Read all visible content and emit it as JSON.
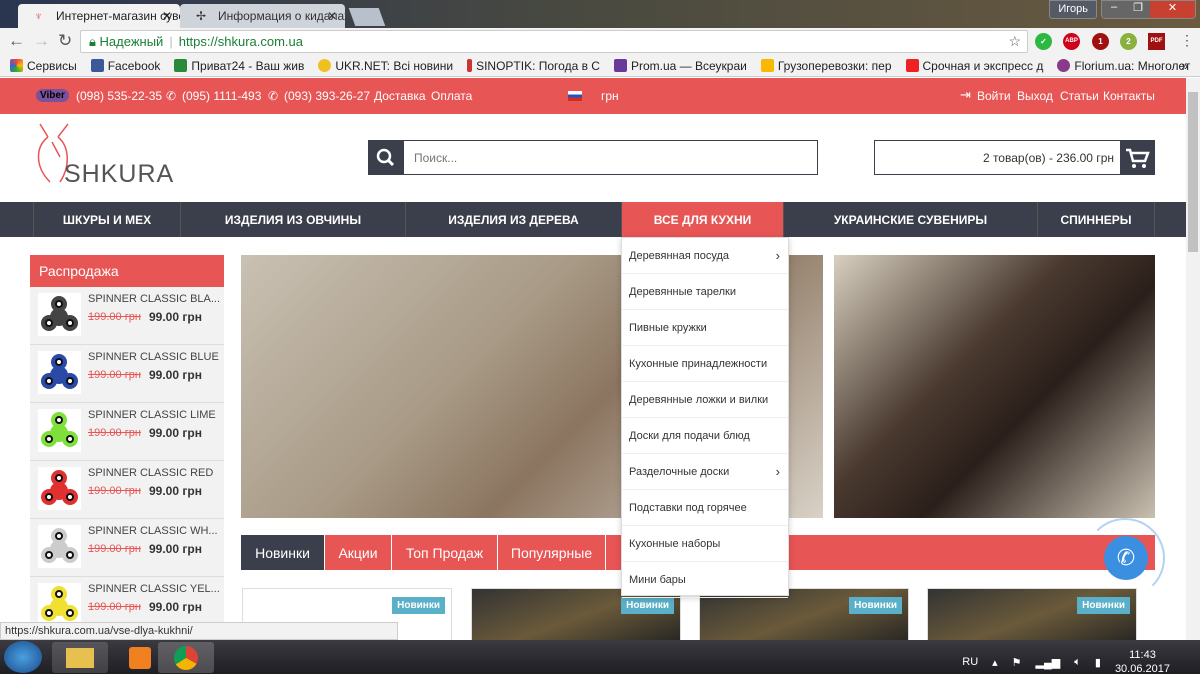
{
  "browser": {
    "tabs": [
      {
        "title": "Интернет-магазин сувенир",
        "close": "✕"
      },
      {
        "title": "Информация о кидалах",
        "close": "✕"
      }
    ],
    "user": "Игорь",
    "secure_label": "Надежный",
    "url": "https://shkura.com.ua",
    "bookmarks": [
      {
        "label": "Сервисы",
        "color": "#e44"
      },
      {
        "label": "Facebook",
        "color": "#3b5998"
      },
      {
        "label": "Приват24 - Ваш жив",
        "color": "#2a8a3a"
      },
      {
        "label": "UKR.NET: Всі новини",
        "color": "#f0c020"
      },
      {
        "label": "SINOPTIK: Погода в С",
        "color": "#c33"
      },
      {
        "label": "Prom.ua — Всеукраи",
        "color": "#6a3a9a"
      },
      {
        "label": "Грузоперевозки: пер",
        "color": "#fbb800"
      },
      {
        "label": "Срочная и экспресс д",
        "color": "#e22"
      },
      {
        "label": "Florium.ua: Многолет",
        "color": "#8a3a8a"
      }
    ],
    "bookmarks_more": "»",
    "extensions": [
      {
        "label": "✓",
        "color": "#2db842"
      },
      {
        "label": "ABP",
        "color": "#d0021b"
      },
      {
        "label": "1",
        "color": "#a01010"
      },
      {
        "label": "2",
        "color": "#8ab040"
      },
      {
        "label": "PDF",
        "color": "#a01010"
      }
    ],
    "status_url": "https://shkura.com.ua/vse-dlya-kukhni/"
  },
  "topbar": {
    "viber": "Viber",
    "phones": [
      "(098) 535-22-35",
      "(095) 1111-493",
      "(093) 393-26-27"
    ],
    "links": [
      "Доставка",
      "Оплата"
    ],
    "currency": "грн",
    "right_links": [
      "Войти",
      "Выход",
      "Статьи",
      "Контакты"
    ]
  },
  "header": {
    "logo": "SHKURA",
    "search_placeholder": "Поиск...",
    "cart": "2 товар(ов) - 236.00 грн"
  },
  "nav": [
    "ШКУРЫ И МЕХ",
    "ИЗДЕЛИЯ ИЗ ОВЧИНЫ",
    "ИЗДЕЛИЯ ИЗ ДЕРЕВА",
    "ВСЕ ДЛЯ КУХНИ",
    "УКРАИНСКИЕ СУВЕНИРЫ",
    "СПИННЕРЫ"
  ],
  "dropdown": [
    "Деревянная посуда",
    "Деревянные тарелки",
    "Пивные кружки",
    "Кухонные принадлежности",
    "Деревянные ложки и вилки",
    "Доски для подачи блюд",
    "Разделочные доски",
    "Подставки под горячее",
    "Кухонные наборы",
    "Мини бары"
  ],
  "sidebar": {
    "title": "Распродажа",
    "items": [
      {
        "name": "SPINNER CLASSIC BLA...",
        "old": "199.00 грн",
        "new": "99.00 грн",
        "color": "#444"
      },
      {
        "name": "SPINNER CLASSIC BLUE",
        "old": "199.00 грн",
        "new": "99.00 грн",
        "color": "#2a4aa8"
      },
      {
        "name": "SPINNER CLASSIC LIME",
        "old": "199.00 грн",
        "new": "99.00 грн",
        "color": "#7ee03a"
      },
      {
        "name": "SPINNER CLASSIC RED",
        "old": "199.00 грн",
        "new": "99.00 грн",
        "color": "#e03030"
      },
      {
        "name": "SPINNER CLASSIC WH...",
        "old": "199.00 грн",
        "new": "99.00 грн",
        "color": "#ccc"
      },
      {
        "name": "SPINNER CLASSIC YEL...",
        "old": "199.00 грн",
        "new": "99.00 грн",
        "color": "#f0e030"
      }
    ]
  },
  "product_tabs": [
    "Новинки",
    "Акции",
    "Топ Продаж",
    "Популярные"
  ],
  "cards": [
    {
      "badge": "Новинки"
    },
    {
      "badge": "Новинки"
    },
    {
      "badge": "Новинки"
    },
    {
      "badge": "Новинки"
    }
  ],
  "taskbar": {
    "lang": "RU",
    "time": "11:43",
    "date": "30.06.2017"
  }
}
